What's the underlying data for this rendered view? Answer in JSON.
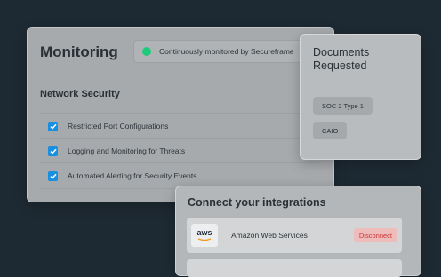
{
  "monitoring": {
    "title": "Monitoring",
    "status": {
      "text": "Continuously monitored by Secureframe",
      "color": "#1ecb7a"
    },
    "section_title": "Network Security",
    "checks": [
      {
        "label": "Restricted Port Configurations",
        "checked": true
      },
      {
        "label": "Logging and Monitoring for Threats",
        "checked": true
      },
      {
        "label": "Automated Alerting for Security Events",
        "checked": true
      }
    ]
  },
  "documents": {
    "title": "Documents Requested",
    "tags": [
      "SOC 2 Type 1",
      "CAIO"
    ]
  },
  "integrations": {
    "title": "Connect your integrations",
    "items": [
      {
        "logo_text": "aws",
        "name": "Amazon Web Services",
        "action": "Disconnect",
        "action_color": "#c8373a"
      }
    ]
  },
  "colors": {
    "background": "#1e2a33",
    "checkbox": "#1a8fe0"
  }
}
